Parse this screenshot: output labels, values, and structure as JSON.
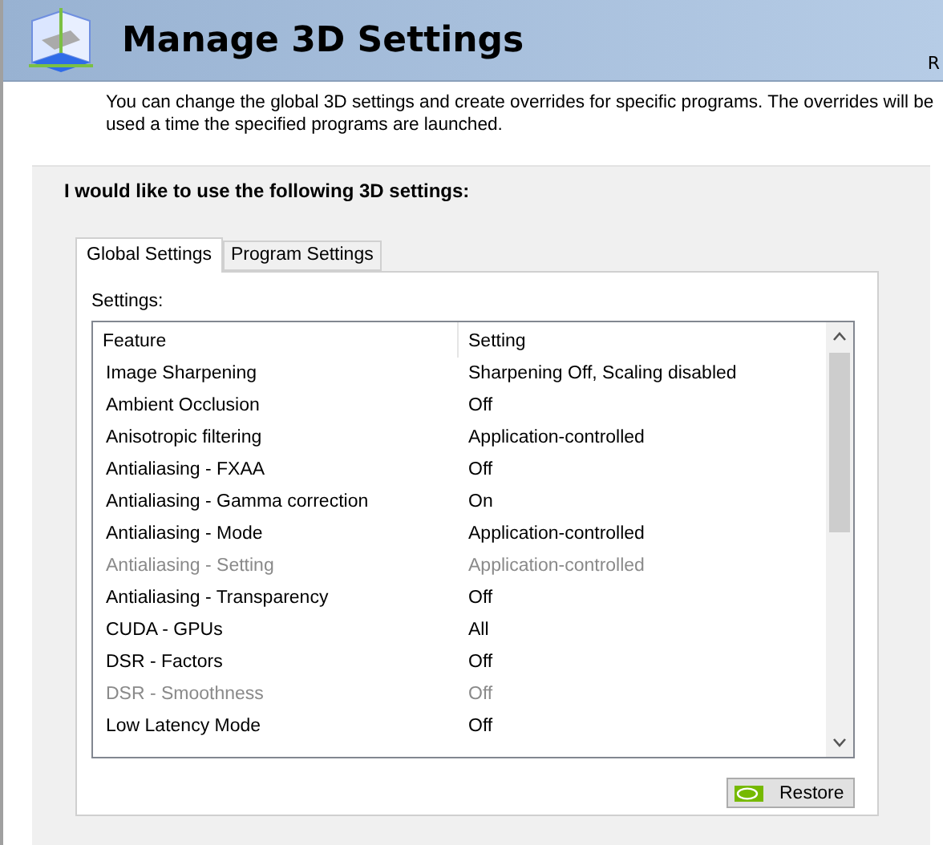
{
  "header": {
    "title": "Manage 3D Settings",
    "corner_text": "R"
  },
  "description": "You can change the global 3D settings and create overrides for specific programs. The overrides will be used a time the specified programs are launched.",
  "panel": {
    "heading": "I would like to use the following 3D settings:",
    "tabs": [
      {
        "label": "Global Settings",
        "selected": true
      },
      {
        "label": "Program Settings",
        "selected": false
      }
    ],
    "settings_label": "Settings:",
    "columns": [
      "Feature",
      "Setting"
    ],
    "rows": [
      {
        "feature": "Image Sharpening",
        "setting": "Sharpening Off, Scaling disabled",
        "disabled": false
      },
      {
        "feature": "Ambient Occlusion",
        "setting": "Off",
        "disabled": false
      },
      {
        "feature": "Anisotropic filtering",
        "setting": "Application-controlled",
        "disabled": false
      },
      {
        "feature": "Antialiasing - FXAA",
        "setting": "Off",
        "disabled": false
      },
      {
        "feature": "Antialiasing - Gamma correction",
        "setting": "On",
        "disabled": false
      },
      {
        "feature": "Antialiasing - Mode",
        "setting": "Application-controlled",
        "disabled": false
      },
      {
        "feature": "Antialiasing - Setting",
        "setting": "Application-controlled",
        "disabled": true
      },
      {
        "feature": "Antialiasing - Transparency",
        "setting": "Off",
        "disabled": false
      },
      {
        "feature": "CUDA - GPUs",
        "setting": "All",
        "disabled": false
      },
      {
        "feature": "DSR - Factors",
        "setting": "Off",
        "disabled": false
      },
      {
        "feature": "DSR - Smoothness",
        "setting": "Off",
        "disabled": true
      },
      {
        "feature": "Low Latency Mode",
        "setting": "Off",
        "disabled": false
      }
    ],
    "restore_button": "Restore"
  }
}
